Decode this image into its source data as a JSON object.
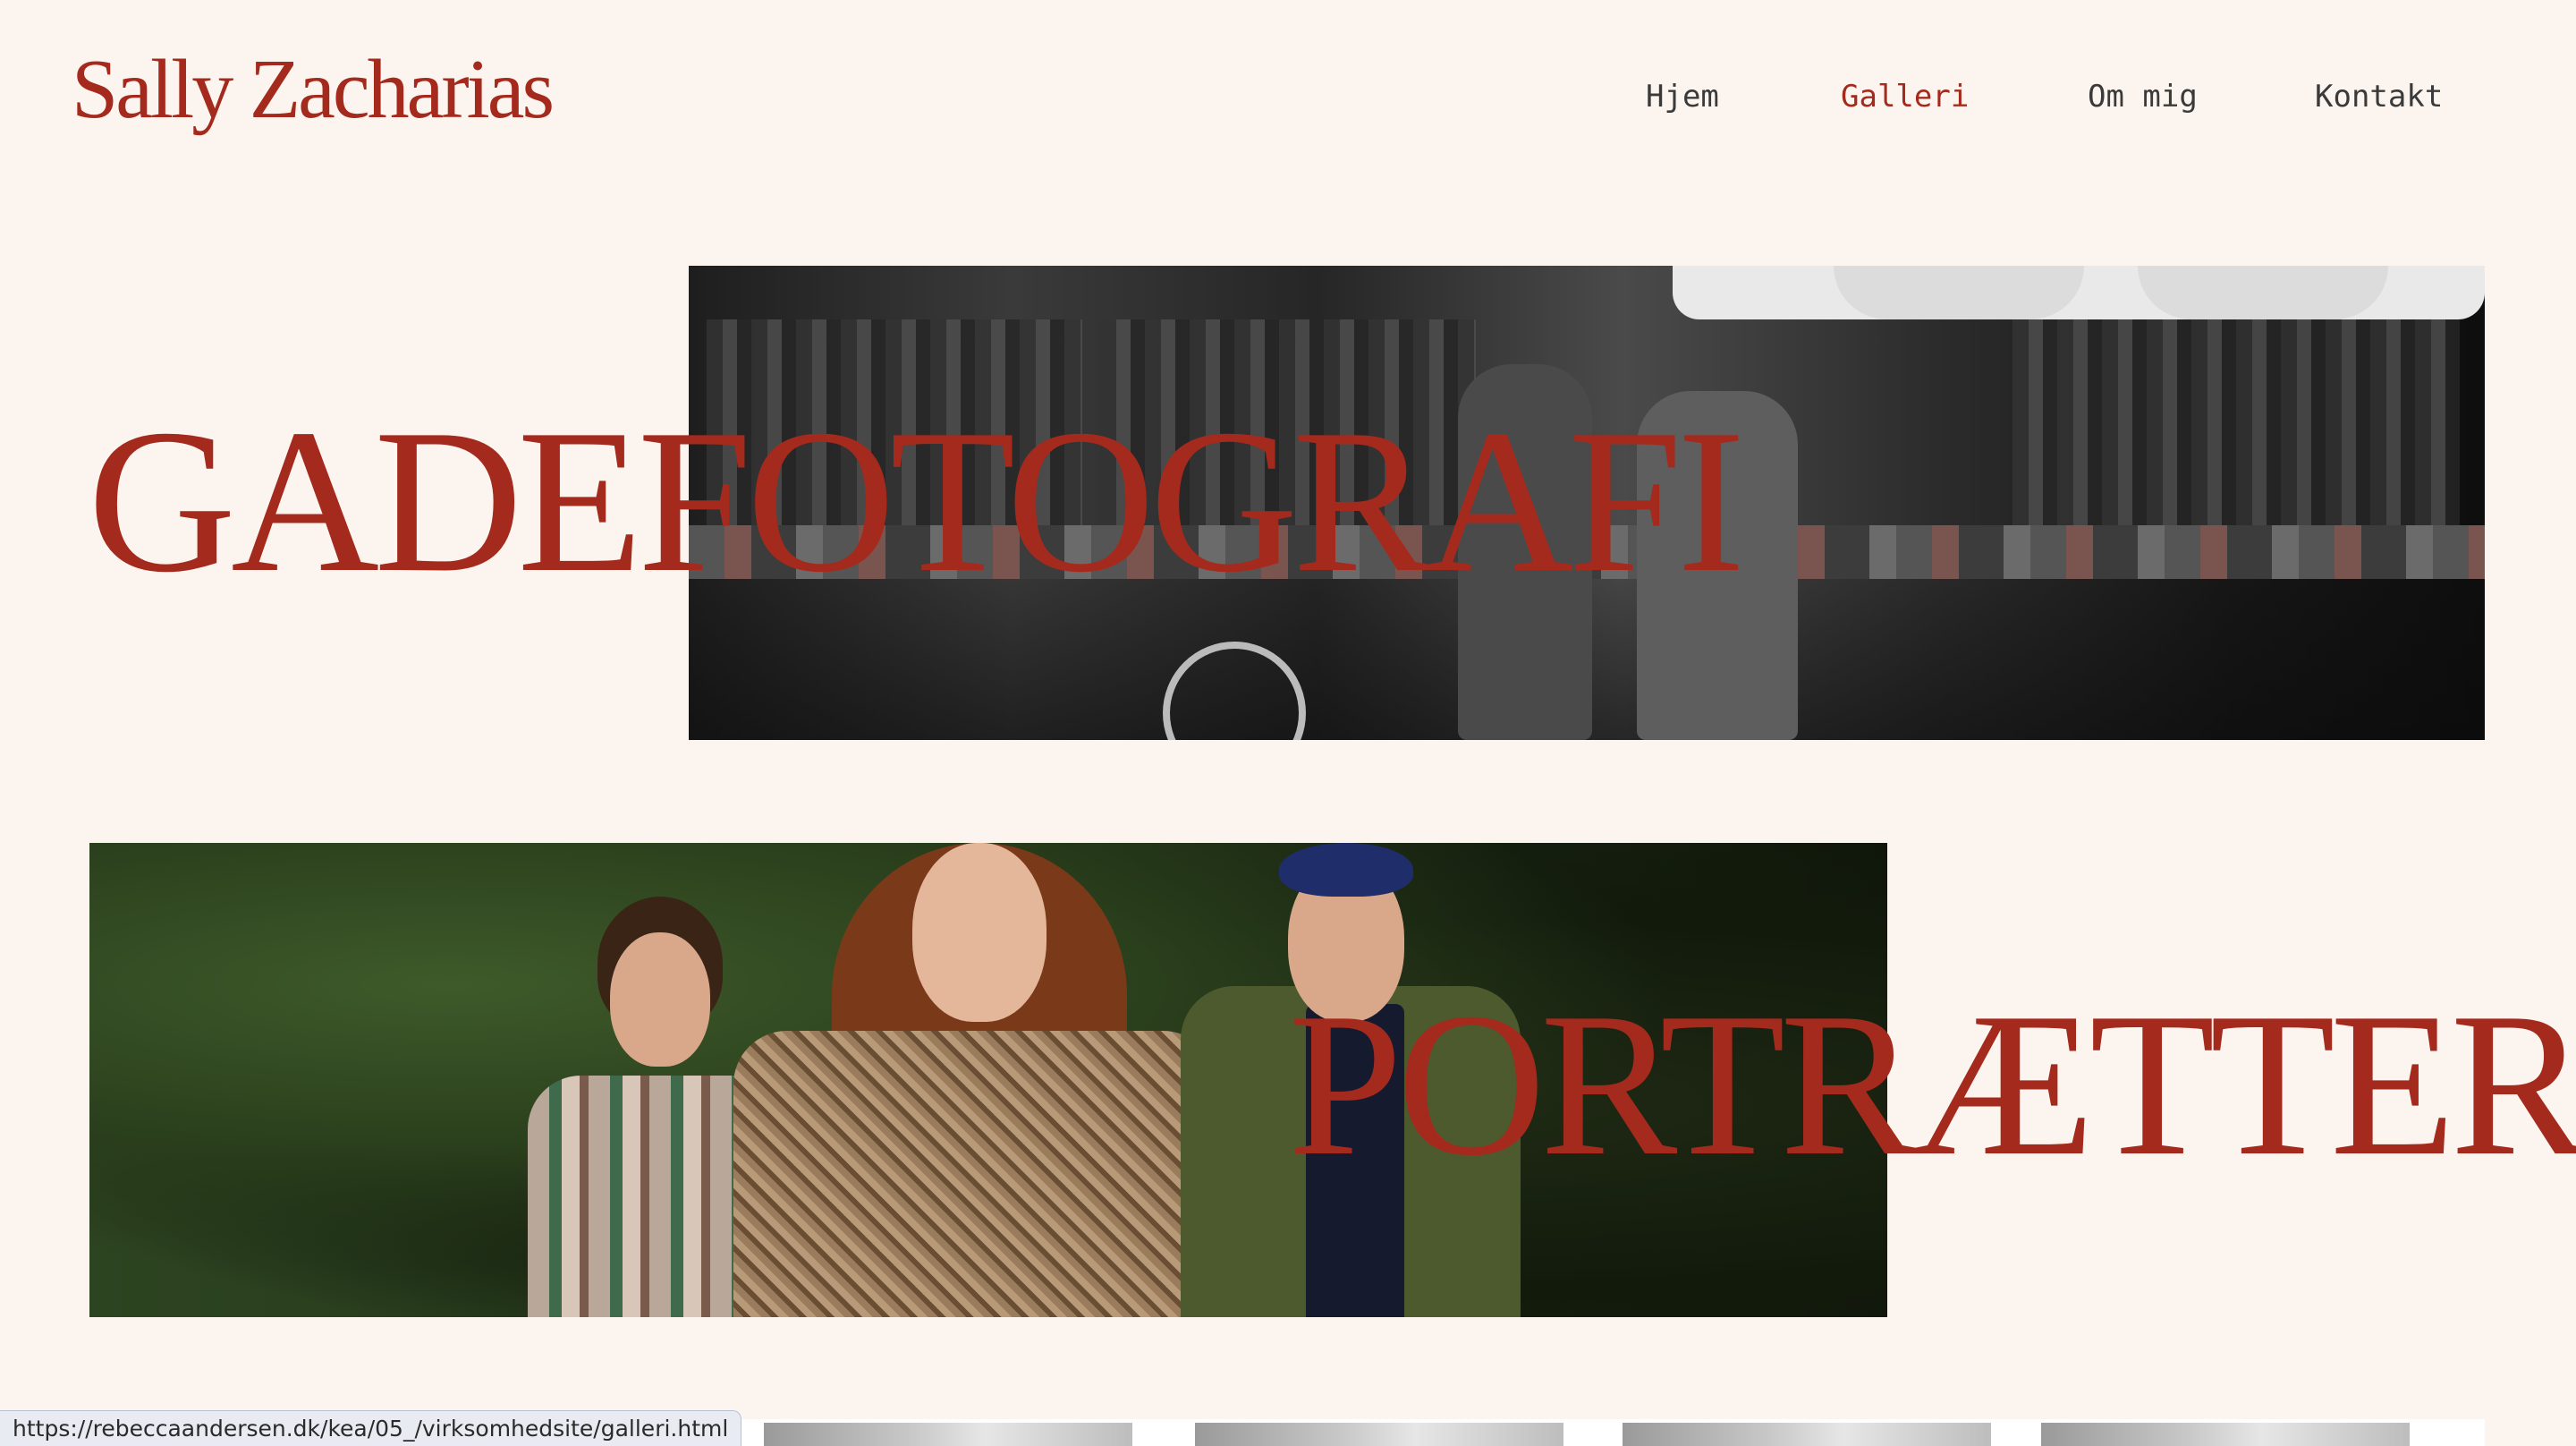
{
  "header": {
    "logo": "Sally Zacharias",
    "nav": [
      {
        "label": "Hjem",
        "active": false
      },
      {
        "label": "Galleri",
        "active": true
      },
      {
        "label": "Om mig",
        "active": false
      },
      {
        "label": "Kontakt",
        "active": false
      }
    ]
  },
  "gallery": {
    "sections": [
      {
        "title": "GADEFOTOGRAFI",
        "image": "street-market-bw-photo"
      },
      {
        "title": "PORTRÆTTER",
        "image": "three-people-portrait-photo"
      }
    ],
    "thumbnails": [
      "thumb-1",
      "thumb-2",
      "thumb-3",
      "thumb-4"
    ]
  },
  "statusbar": {
    "url": "https://rebeccaandersen.dk/kea/05_/virksomhedsite/galleri.html"
  },
  "colors": {
    "background": "#fcf5ef",
    "accent": "#a52a1e",
    "nav_text": "#3a3a3a"
  }
}
